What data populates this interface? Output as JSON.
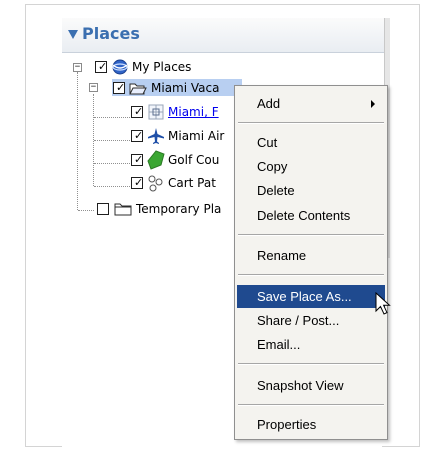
{
  "panel": {
    "title": "Places"
  },
  "tree": {
    "my_places": "My Places",
    "miami_vacation": "Miami Vaca",
    "miami_fl": "Miami, F",
    "miami_airport": "Miami Air",
    "golf_course": "Golf Cou",
    "cart_path": "Cart Pat",
    "temporary_places": "Temporary Pla"
  },
  "context_menu": {
    "add": "Add",
    "cut": "Cut",
    "copy": "Copy",
    "delete": "Delete",
    "delete_contents": "Delete Contents",
    "rename": "Rename",
    "save_place_as": "Save Place As...",
    "share_post": "Share / Post...",
    "email": "Email...",
    "snapshot_view": "Snapshot View",
    "properties": "Properties"
  },
  "colors": {
    "header_text": "#3b6fb0",
    "selection": "#b8cff1",
    "menu_highlight": "#1f4a8f",
    "link": "#0000ee"
  }
}
